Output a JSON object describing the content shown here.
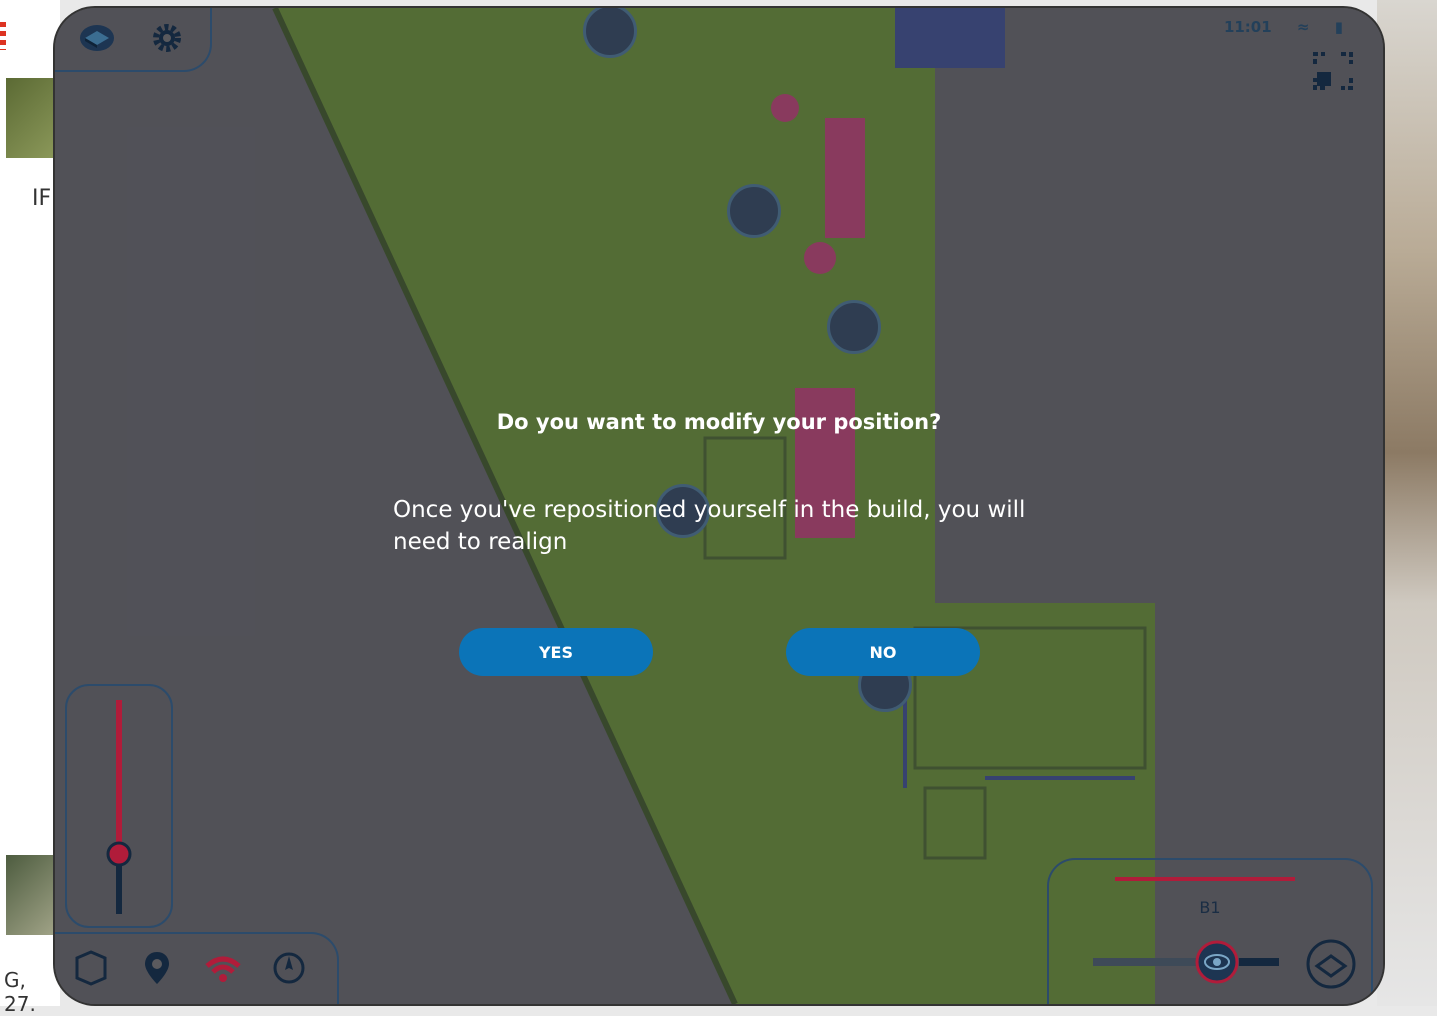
{
  "status_bar": {
    "time": "11:01"
  },
  "left_panel": {
    "text": "IF",
    "bottom_text": "G, 27."
  },
  "dialog": {
    "title": "Do you want to modify your position?",
    "message": "Once you've repositioned yourself in the build, you will need to realign",
    "yes_label": "YES",
    "no_label": "NO"
  },
  "floor_selector": {
    "floor_label": "B1"
  },
  "colors": {
    "button": "#0b74b8",
    "accent_red": "#b01c3a",
    "panel_border": "#2c4b6b",
    "floorplan_green": "#5e8a1f"
  },
  "icons": {
    "top_left": [
      "building-icon",
      "settings-gear-icon"
    ],
    "bottom_toolbar": [
      "view-cube-icon",
      "location-pin-icon",
      "wifi-heatmap-icon",
      "navigation-compass-icon"
    ],
    "floor": [
      "eye-icon",
      "layers-icon"
    ],
    "top_right": "fullscreen-exit-icon"
  }
}
